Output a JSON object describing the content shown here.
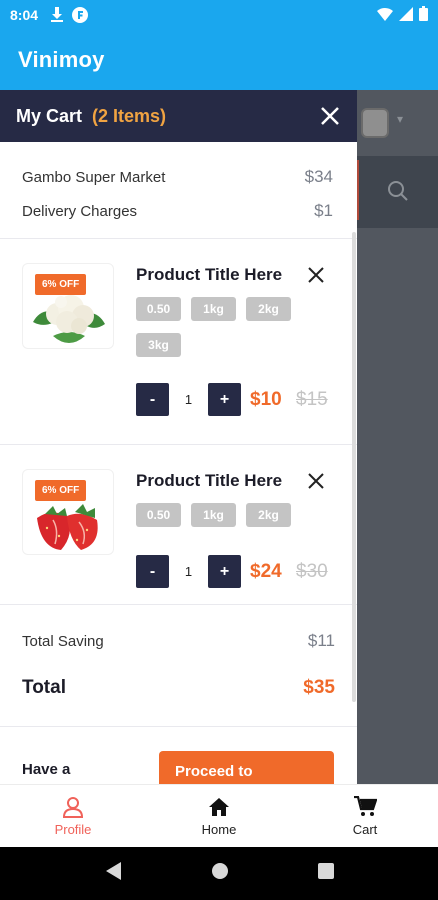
{
  "status_bar": {
    "time": "8:04"
  },
  "app_bar": {
    "title": "Vinimoy"
  },
  "cart": {
    "title": "My Cart",
    "count": "(2 Items)",
    "summary": [
      {
        "label": "Gambo Super Market",
        "amount": "$34"
      },
      {
        "label": "Delivery Charges",
        "amount": "$1"
      }
    ],
    "items": [
      {
        "discount": "6% OFF",
        "title": "Product Title Here",
        "options": [
          "0.50",
          "1kg",
          "2kg",
          "3kg"
        ],
        "quantity": "1",
        "price": "$10",
        "old_price": "$15",
        "minus": "-",
        "plus": "+",
        "image": "cauliflower"
      },
      {
        "discount": "6% OFF",
        "title": "Product Title Here",
        "options": [
          "0.50",
          "1kg",
          "2kg"
        ],
        "quantity": "1",
        "price": "$24",
        "old_price": "$30",
        "minus": "-",
        "plus": "+",
        "image": "strawberry"
      }
    ],
    "total_saving_label": "Total Saving",
    "total_saving": "$11",
    "total_label": "Total",
    "total": "$35",
    "coupon_text": "Have a",
    "proceed_label": "Proceed to"
  },
  "bottom_nav": [
    {
      "label": "Profile",
      "icon": "profile-icon",
      "active": true
    },
    {
      "label": "Home",
      "icon": "home-icon",
      "active": false
    },
    {
      "label": "Cart",
      "icon": "cart-icon",
      "active": false
    }
  ],
  "colors": {
    "primary": "#1aa7ee",
    "drawer_header": "#262a45",
    "accent": "#f06a2a",
    "count": "#f0a342",
    "chip": "#c4c4c4",
    "active_nav": "#f0625a"
  }
}
